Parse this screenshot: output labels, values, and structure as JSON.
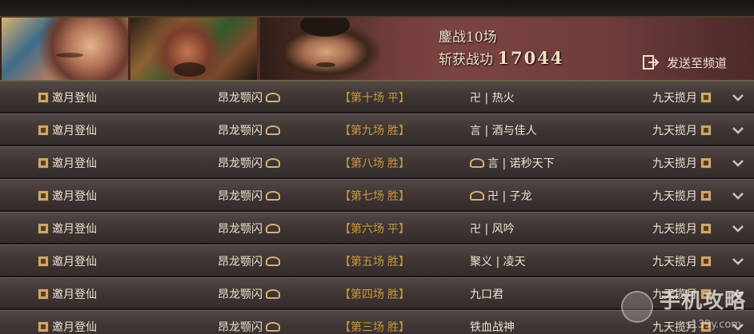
{
  "banner": {
    "battles_line": "鏖战10场",
    "merit_label": "斩获战功",
    "merit_value": "17044",
    "send_button": "发送至频道"
  },
  "records": [
    {
      "left_name": "邀月登仙",
      "mid_name": "昂龙颚闪",
      "round": "【第十场",
      "result": "平】",
      "opponent": "卍 | 热火",
      "opp_emblem": "none",
      "right_name": "九天揽月"
    },
    {
      "left_name": "邀月登仙",
      "mid_name": "昂龙颚闪",
      "round": "【第九场",
      "result": "胜】",
      "opponent": "言 | 酒与佳人",
      "opp_emblem": "none",
      "right_name": "九天揽月"
    },
    {
      "left_name": "邀月登仙",
      "mid_name": "昂龙颚闪",
      "round": "【第八场",
      "result": "胜】",
      "opponent": "言 | 诺秒天下",
      "opp_emblem": "flower",
      "right_name": "九天揽月"
    },
    {
      "left_name": "邀月登仙",
      "mid_name": "昂龙颚闪",
      "round": "【第七场",
      "result": "胜】",
      "opponent": "卍 | 子龙",
      "opp_emblem": "flower",
      "right_name": "九天揽月"
    },
    {
      "left_name": "邀月登仙",
      "mid_name": "昂龙颚闪",
      "round": "【第六场",
      "result": "平】",
      "opponent": "卍 | 风吟",
      "opp_emblem": "none",
      "right_name": "九天揽月"
    },
    {
      "left_name": "邀月登仙",
      "mid_name": "昂龙颚闪",
      "round": "【第五场",
      "result": "胜】",
      "opponent": "聚义 | 凌天",
      "opp_emblem": "none",
      "right_name": "九天揽月"
    },
    {
      "left_name": "邀月登仙",
      "mid_name": "昂龙颚闪",
      "round": "【第四场",
      "result": "胜】",
      "opponent": "九口君",
      "opp_emblem": "none",
      "right_name": "九天揽月"
    },
    {
      "left_name": "邀月登仙",
      "mid_name": "昂龙颚闪",
      "round": "【第三场",
      "result": "胜】",
      "opponent": "铁血战神",
      "opp_emblem": "none",
      "right_name": "九天揽月"
    }
  ],
  "watermark": {
    "title": "手机攻略",
    "url": "s139y.com"
  },
  "icons": {
    "send": "export-arrow-icon",
    "expand": "chevron-down-icon",
    "guild_badge": "guild-badge-icon",
    "flower_badge": "flower-badge-icon"
  },
  "colors": {
    "round_text": "#c9983e",
    "row_text": "#eee3d2",
    "banner_text": "#f0e0c2"
  }
}
